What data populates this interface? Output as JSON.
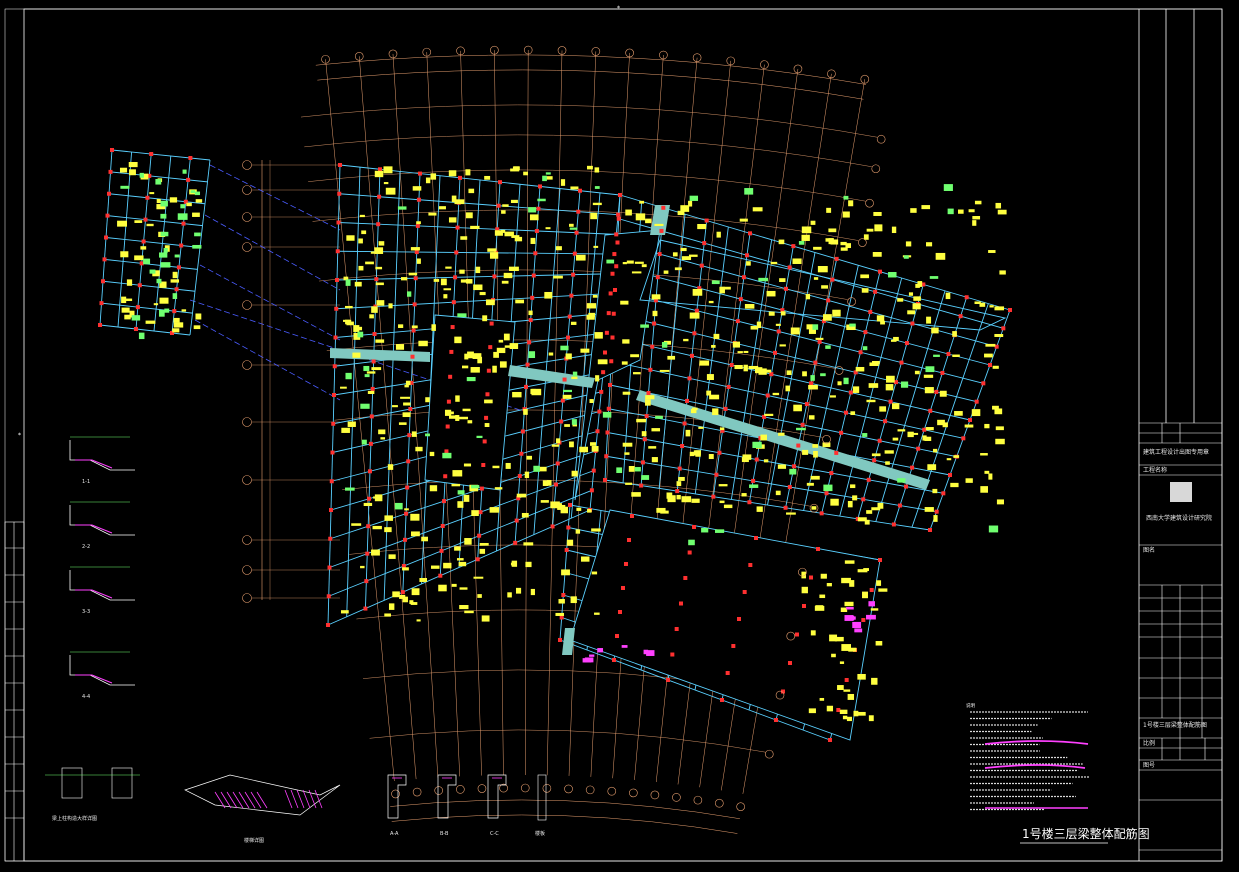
{
  "drawing": {
    "sheet_title": "1号楼三层梁整体配筋图",
    "notes_heading": "说明"
  },
  "colors": {
    "background": "#000000",
    "frame": "#ffffff",
    "axis_grid": "#e8a070",
    "axis_dashed": "#4a5cff",
    "beam": "#5ad0ff",
    "column": "#ff3030",
    "annotation": "#ffff40",
    "green_text": "#70ff70",
    "magenta": "#ff40ff",
    "wide_beam": "#80c8c0"
  },
  "title_block": {
    "stamp_text": "建筑工程设计出图专用章",
    "company": "西南大学建筑设计研究院",
    "project_label": "工程名称",
    "drawing_label": "图名",
    "drawing_name": "1号楼三层梁整体配筋图",
    "scale_label": "比例",
    "sheet_label": "图号"
  },
  "detail_captions": [
    "1-1",
    "2-2",
    "3-3",
    "4-4",
    "梁上柱构造大样详图",
    "楼梯详图",
    "A-A",
    "B-B",
    "C-C",
    "楼板"
  ]
}
